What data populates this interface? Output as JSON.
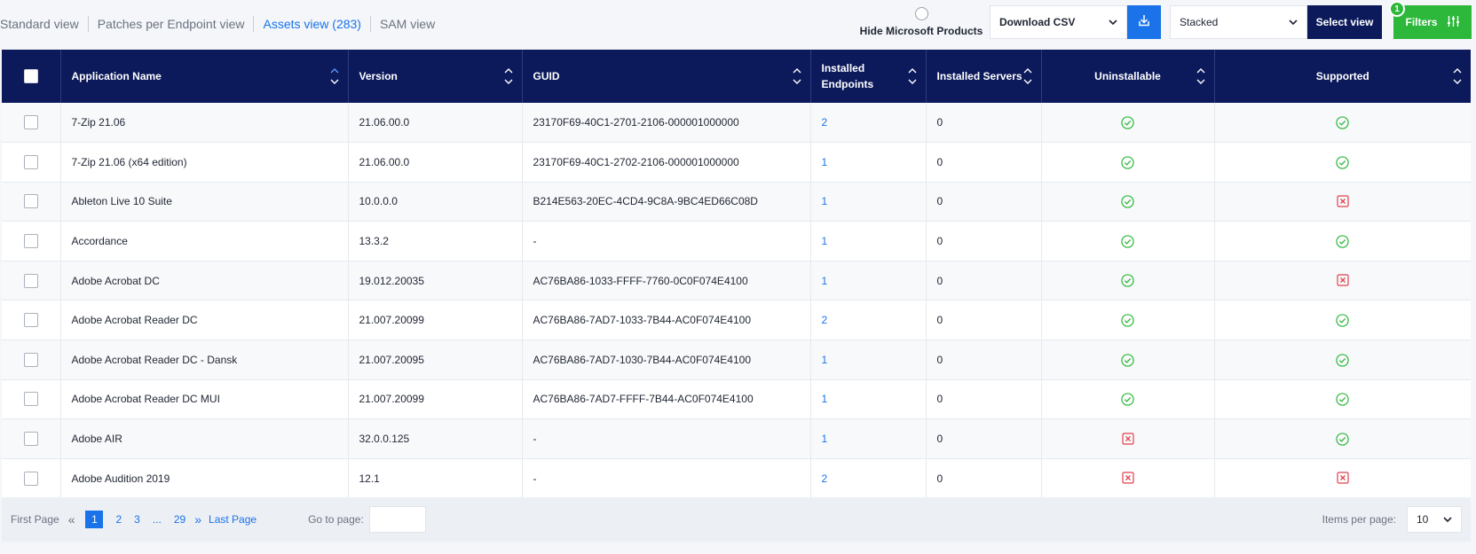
{
  "tabs": [
    {
      "label": "Standard view",
      "active": false
    },
    {
      "label": "Patches per Endpoint view",
      "active": false
    },
    {
      "label": "Assets view (283)",
      "active": true
    },
    {
      "label": "SAM view",
      "active": false
    }
  ],
  "toolbar": {
    "hide_ms_label": "Hide Microsoft Products",
    "export_select": "Download CSV",
    "download_icon": "download-icon",
    "layout_select": "Stacked",
    "select_view_label": "Select view",
    "filters_label": "Filters",
    "filters_badge": "1"
  },
  "table": {
    "columns": [
      "Application Name",
      "Version",
      "GUID",
      "Installed Endpoints",
      "Installed Servers",
      "Uninstallable",
      "Supported"
    ],
    "columns_display": [
      "Application Name",
      "Version",
      "GUID",
      "Installed\nEndpoints",
      "Installed Servers",
      "Uninstallable",
      "Supported"
    ],
    "rows": [
      {
        "name": "7-Zip 21.06",
        "version": "21.06.00.0",
        "guid": "23170F69-40C1-2701-2106-000001000000",
        "endpoints": "2",
        "servers": "0",
        "uninstallable": true,
        "supported": true
      },
      {
        "name": "7-Zip 21.06 (x64 edition)",
        "version": "21.06.00.0",
        "guid": "23170F69-40C1-2702-2106-000001000000",
        "endpoints": "1",
        "servers": "0",
        "uninstallable": true,
        "supported": true
      },
      {
        "name": "Ableton Live 10 Suite",
        "version": "10.0.0.0",
        "guid": "B214E563-20EC-4CD4-9C8A-9BC4ED66C08D",
        "endpoints": "1",
        "servers": "0",
        "uninstallable": true,
        "supported": false
      },
      {
        "name": "Accordance",
        "version": "13.3.2",
        "guid": "-",
        "endpoints": "1",
        "servers": "0",
        "uninstallable": true,
        "supported": true
      },
      {
        "name": "Adobe Acrobat DC",
        "version": "19.012.20035",
        "guid": "AC76BA86-1033-FFFF-7760-0C0F074E4100",
        "endpoints": "1",
        "servers": "0",
        "uninstallable": true,
        "supported": false
      },
      {
        "name": "Adobe Acrobat Reader DC",
        "version": "21.007.20099",
        "guid": "AC76BA86-7AD7-1033-7B44-AC0F074E4100",
        "endpoints": "2",
        "servers": "0",
        "uninstallable": true,
        "supported": true
      },
      {
        "name": "Adobe Acrobat Reader DC - Dansk",
        "version": "21.007.20095",
        "guid": "AC76BA86-7AD7-1030-7B44-AC0F074E4100",
        "endpoints": "1",
        "servers": "0",
        "uninstallable": true,
        "supported": true
      },
      {
        "name": "Adobe Acrobat Reader DC MUI",
        "version": "21.007.20099",
        "guid": "AC76BA86-7AD7-FFFF-7B44-AC0F074E4100",
        "endpoints": "1",
        "servers": "0",
        "uninstallable": true,
        "supported": true
      },
      {
        "name": "Adobe AIR",
        "version": "32.0.0.125",
        "guid": "-",
        "endpoints": "1",
        "servers": "0",
        "uninstallable": false,
        "supported": true
      },
      {
        "name": "Adobe Audition 2019",
        "version": "12.1",
        "guid": "-",
        "endpoints": "2",
        "servers": "0",
        "uninstallable": false,
        "supported": false
      }
    ]
  },
  "pagination": {
    "first_label": "First Page",
    "pages": [
      "1",
      "2",
      "3",
      "...",
      "29"
    ],
    "current_page": "1",
    "last_label": "Last Page",
    "goto_label": "Go to page:",
    "goto_value": "",
    "items_per_page_label": "Items per page:",
    "items_per_page": "10"
  },
  "colors": {
    "header_bg": "#0c1a5b",
    "accent_blue": "#1a73e8",
    "success_green": "#2eb83b",
    "error_red": "#e0404b"
  }
}
